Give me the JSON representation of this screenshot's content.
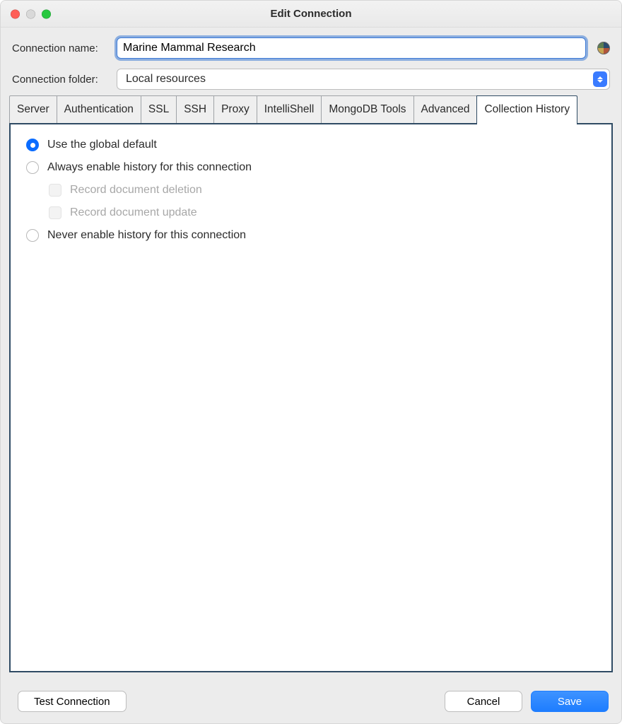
{
  "window": {
    "title": "Edit Connection"
  },
  "form": {
    "name_label": "Connection name:",
    "name_value": "Marine Mammal Research",
    "folder_label": "Connection folder:",
    "folder_value": "Local resources"
  },
  "tabs": {
    "items": [
      {
        "label": "Server"
      },
      {
        "label": "Authentication"
      },
      {
        "label": "SSL"
      },
      {
        "label": "SSH"
      },
      {
        "label": "Proxy"
      },
      {
        "label": "IntelliShell"
      },
      {
        "label": "MongoDB Tools"
      },
      {
        "label": "Advanced"
      },
      {
        "label": "Collection History"
      }
    ],
    "active_index": 8
  },
  "history_options": {
    "use_global_default": "Use the global default",
    "always_enable": "Always enable history for this connection",
    "record_deletion": "Record document deletion",
    "record_update": "Record document update",
    "never_enable": "Never enable history for this connection",
    "selected": "use_global_default"
  },
  "buttons": {
    "test": "Test Connection",
    "cancel": "Cancel",
    "save": "Save"
  }
}
